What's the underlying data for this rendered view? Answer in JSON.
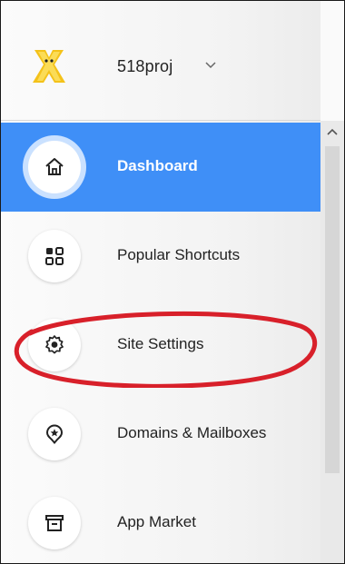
{
  "header": {
    "site_name": "518proj",
    "logo_icon": "wix-logo-icon",
    "caret_icon": "chevron-down-icon"
  },
  "nav": {
    "items": [
      {
        "label": "Dashboard",
        "icon": "home-icon",
        "active": true
      },
      {
        "label": "Popular Shortcuts",
        "icon": "grid-icon",
        "active": false
      },
      {
        "label": "Site Settings",
        "icon": "gear-icon",
        "active": false
      },
      {
        "label": "Domains & Mailboxes",
        "icon": "badge-star-icon",
        "active": false
      },
      {
        "label": "App Market",
        "icon": "store-icon",
        "active": false
      }
    ]
  },
  "colors": {
    "active_bg": "#3f8ff7",
    "annotation": "#d8202a"
  }
}
